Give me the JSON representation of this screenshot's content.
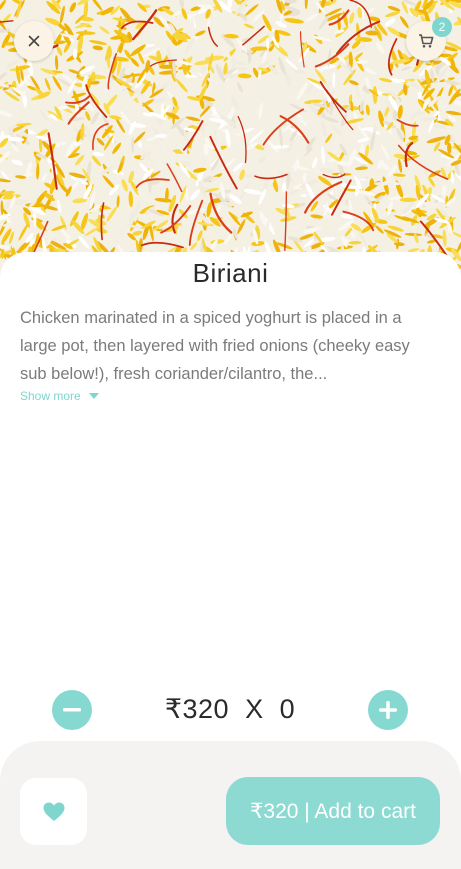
{
  "header": {
    "close_icon": "close-icon",
    "cart_icon": "cart-icon",
    "cart_count": "2"
  },
  "product": {
    "name": "Biriani",
    "description": "Chicken marinated in a spiced yoghurt is placed in a large pot, then layered with fried onions (cheeky easy sub below!), fresh coriander/cilantro, the...",
    "show_more_label": "Show more"
  },
  "quantity": {
    "price": "₹320",
    "separator": "X",
    "count": "0",
    "decrement_icon": "minus-icon",
    "increment_icon": "plus-icon"
  },
  "actions": {
    "favorite_icon": "heart-icon",
    "add_to_cart_label": "₹320 | Add to cart"
  },
  "colors": {
    "accent": "#8ddad3",
    "badge": "#7fd6cf",
    "sheet_bottom": "#f4f3f2"
  }
}
